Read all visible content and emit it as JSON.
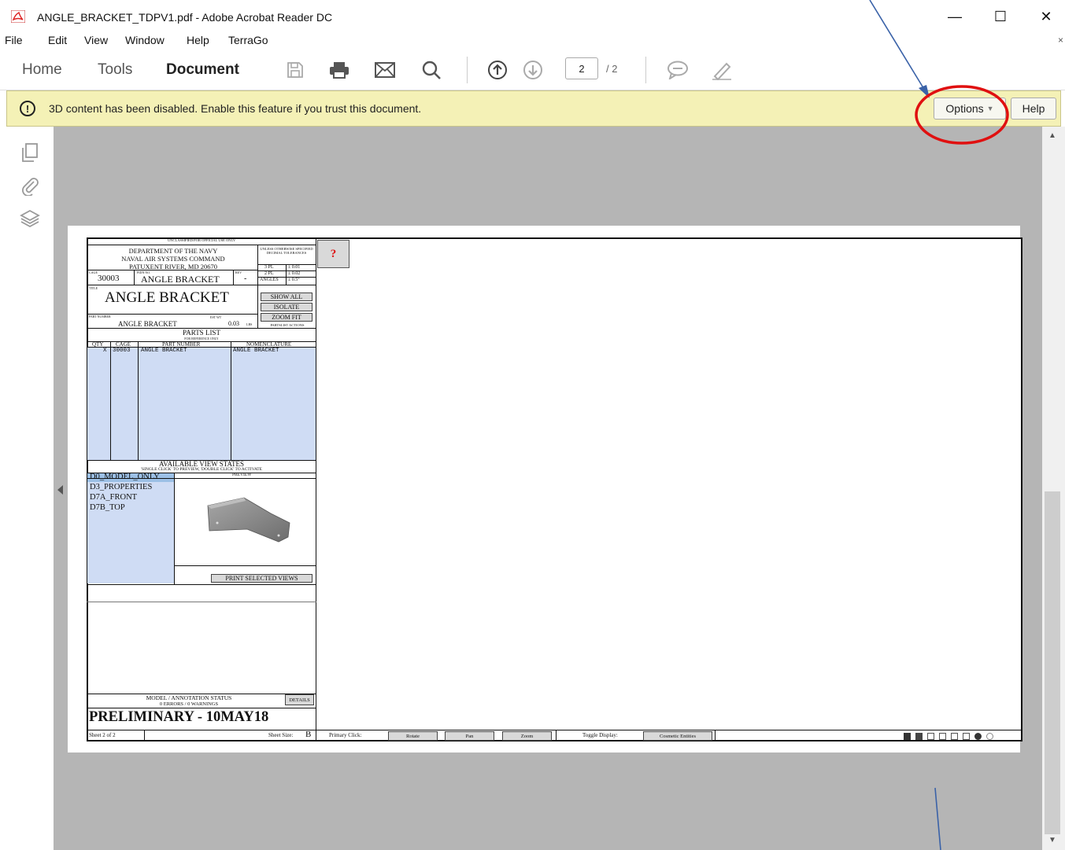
{
  "window": {
    "title": "ANGLE_BRACKET_TDPV1.pdf - Adobe Acrobat Reader DC",
    "controls": [
      "—",
      "☐",
      "✕"
    ]
  },
  "menu": [
    "File",
    "Edit",
    "View",
    "Window",
    "Help",
    "TerraGo"
  ],
  "toolbar": {
    "tabs": [
      "Home",
      "Tools",
      "Document"
    ],
    "page_current": "2",
    "page_total": "/ 2"
  },
  "notification": {
    "message": "3D content has been disabled. Enable this feature if you trust this document.",
    "options_label": "Options",
    "help_label": "Help"
  },
  "drawing": {
    "classification": "UNCLASSIFIED/FOR OFFICIAL USE ONLY",
    "org_line1": "DEPARTMENT OF THE NAVY",
    "org_line2": "NAVAL AIR SYSTEMS COMMAND",
    "org_line3": "PATUXENT RIVER, MD 20670",
    "tol_header": "UNLESS OTHERWISE SPECIFIED",
    "tol_sub": "DECIMAL TOLERANCES",
    "tol_3pl": "3 PL",
    "tol_3pl_val": "± 0.01",
    "tol_2pl": "2 PL",
    "tol_2pl_val": "± 0.02",
    "tol_angles": "ANGLES",
    "tol_angles_val": "± 0.5°",
    "cage_label": "CAGE",
    "cage": "30003",
    "pidn_label": "PIDN NO.",
    "pidn": "ANGLE BRACKET",
    "rev_label": "REV",
    "rev": "-",
    "title_label": "TITLE",
    "title": "ANGLE BRACKET",
    "btn_show_all": "SHOW ALL",
    "btn_isolate": "ISOLATE",
    "btn_zoom_fit": "ZOOM FIT",
    "partslist_actions": "PARTSLIST ACTIONS",
    "part_number_label": "PART NUMBER",
    "part_number": "ANGLE BRACKET",
    "est_wt_label": "EST WT",
    "est_wt": "0.03",
    "est_wt_unit": "LBS",
    "parts_list_title": "PARTS LIST",
    "parts_list_sub": "FOR REFERENCE ONLY",
    "parts_headers": [
      "QTY",
      "CAGE",
      "PART NUMBER",
      "NOMENCLATURE"
    ],
    "parts_row": [
      "X",
      "30003",
      "ANGLE BRACKET",
      "ANGLE BRACKET"
    ],
    "views_title": "AVAILABLE VIEW STATES",
    "views_sub": "'SINGLE CLICK' TO PREVIEW, 'DOUBLE CLICK' TO ACTIVATE",
    "preview_label": "PREVIEW",
    "views": [
      "D0_MODEL_ONLY",
      "D3_PROPERTIES",
      "D7A_FRONT",
      "D7B_TOP"
    ],
    "print_views": "PRINT SELECTED VIEWS",
    "status_title": "MODEL / ANNOTATION STATUS",
    "status_sub": "0 ERRORS / 0 WARNINGS",
    "details": "DETAILS",
    "preliminary": "PRELIMINARY - 10MAY18",
    "sheet": "Sheet 2 of 2",
    "sheet_size_label": "Sheet Size:",
    "sheet_size": "B",
    "primary_click": "Primary Click:",
    "rotate": "Rotate",
    "pan": "Pan",
    "zoom": "Zoom",
    "toggle_display": "Toggle Display:",
    "cosmetic": "Cosmetic Entities",
    "help_q": "?"
  },
  "colors": {
    "notify_bg": "#f4f1b6",
    "doc_bg": "#b5b5b5",
    "highlight": "#e01010",
    "arrow": "#3a62a8"
  }
}
